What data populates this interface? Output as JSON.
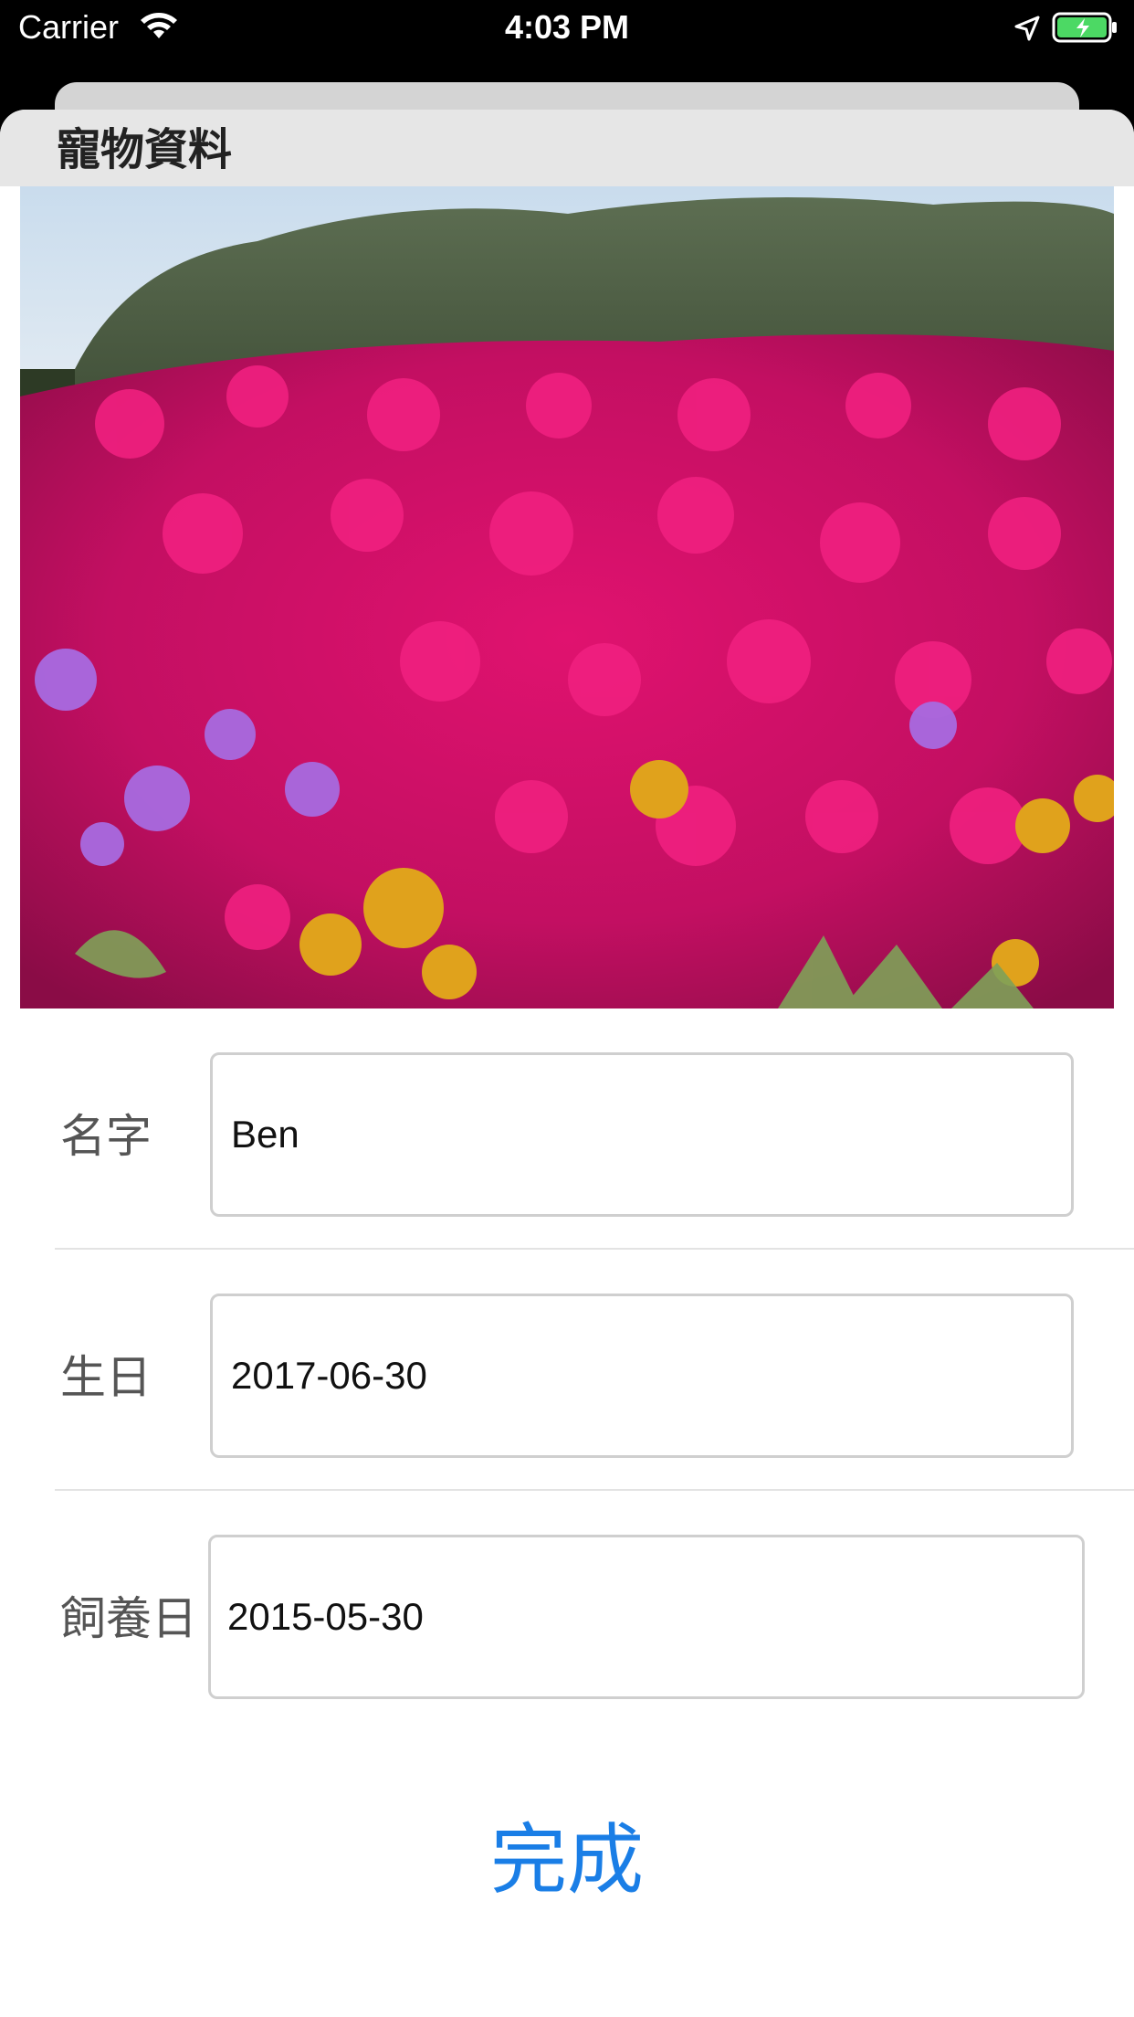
{
  "status_bar": {
    "carrier": "Carrier",
    "time": "4:03 PM",
    "icons": [
      "wifi-icon",
      "location-arrow-icon",
      "battery-charging-icon"
    ],
    "battery_color": "#4cd964"
  },
  "nav": {
    "title": "寵物資料"
  },
  "photo": {
    "subject": "flower-field-photo"
  },
  "form": {
    "name": {
      "label": "名字",
      "value": "Ben"
    },
    "birthday": {
      "label": "生日",
      "value": "2017-06-30"
    },
    "adoption_date": {
      "label": "飼養日",
      "value": "2015-05-30"
    }
  },
  "actions": {
    "done_label": "完成"
  },
  "colors": {
    "accent": "#1a7ee6",
    "nav_background": "#e6e6e6",
    "field_border": "#cfcfcf"
  }
}
